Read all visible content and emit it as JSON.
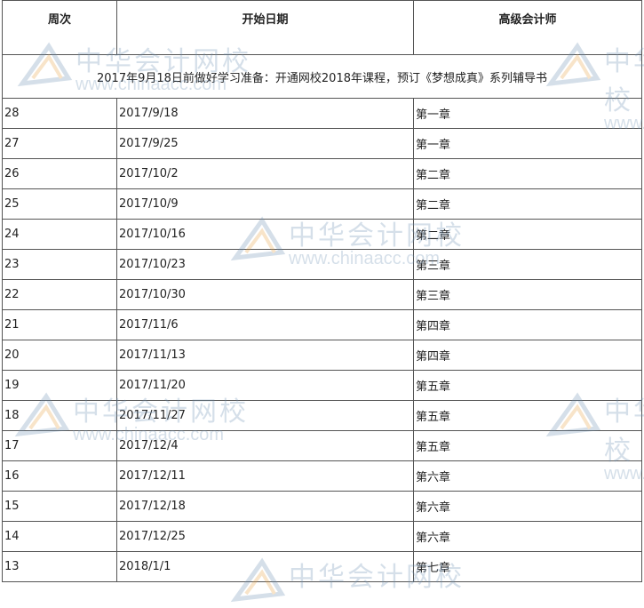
{
  "table": {
    "headers": [
      "周次",
      "开始日期",
      "高级会计师"
    ],
    "notice": "2017年9月18日前做好学习准备：开通网校2018年课程，预订《梦想成真》系列辅导书",
    "rows": [
      [
        "28",
        "2017/9/18",
        "第一章"
      ],
      [
        "27",
        "2017/9/25",
        "第一章"
      ],
      [
        "26",
        "2017/10/2",
        "第二章"
      ],
      [
        "25",
        "2017/10/9",
        "第二章"
      ],
      [
        "24",
        "2017/10/16",
        "第二章"
      ],
      [
        "23",
        "2017/10/23",
        "第三章"
      ],
      [
        "22",
        "2017/10/30",
        "第三章"
      ],
      [
        "21",
        "2017/11/6",
        "第四章"
      ],
      [
        "20",
        "2017/11/13",
        "第四章"
      ],
      [
        "19",
        "2017/11/20",
        "第五章"
      ],
      [
        "18",
        "2017/11/27",
        "第五章"
      ],
      [
        "17",
        "2017/12/4",
        "第五章"
      ],
      [
        "16",
        "2017/12/11",
        "第六章"
      ],
      [
        "15",
        "2017/12/18",
        "第六章"
      ],
      [
        "14",
        "2017/12/25",
        "第六章"
      ],
      [
        "13",
        "2018/1/1",
        "第七章"
      ]
    ]
  },
  "watermark": {
    "name": "中华会计网校",
    "url": "www.chinaacc.com",
    "color": "#6a8fb3"
  }
}
